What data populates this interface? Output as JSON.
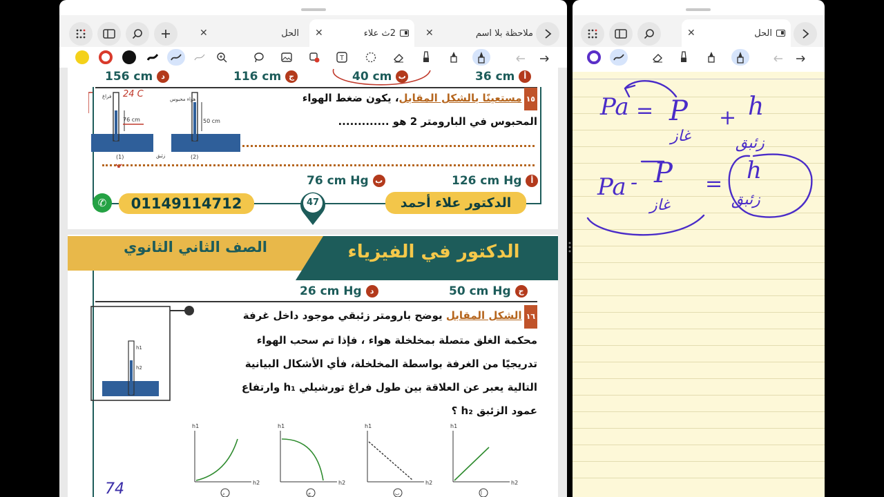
{
  "left_window": {
    "tabs": [
      {
        "label": "ملاحظة بلا اسم"
      },
      {
        "label": "2ث علاء"
      },
      {
        "label": "الحل"
      }
    ],
    "toolbar": {
      "colors": [
        "#f4d11a",
        "#d93a2b",
        "#111111"
      ]
    },
    "page": {
      "top_options": [
        {
          "letter": "د",
          "text": "156 cm"
        },
        {
          "letter": "ج",
          "text": "116 cm"
        },
        {
          "letter": "ب",
          "text": "40 cm"
        },
        {
          "letter": "أ",
          "text": "36 cm"
        }
      ],
      "q15": {
        "number": "١٥",
        "highlight": "مستعينًا بالشكل المقابل",
        "line1": "، يكون ضغط الهواء",
        "line2": "المحبوس في البارومتر 2 هو .............",
        "options": [
          {
            "letter": "ب",
            "text": "76 cm Hg"
          },
          {
            "letter": "أ",
            "text": "126 cm Hg"
          }
        ],
        "figure": {
          "label_vacuum": "فراغ",
          "label_air": "هواء محبوس",
          "label_76": "76 cm",
          "label_50": "50 cm",
          "label_mercury": "زئبق",
          "label_1": "(1)",
          "label_2": "(2)",
          "annotation": "24 C"
        }
      },
      "footer": {
        "phone": "01149114712",
        "page_number": "47",
        "author": "الدكتور علاء أحمد"
      },
      "banner": {
        "grade": "الصف الثاني الثانوي",
        "title": "الدكتور في الفيزياء"
      },
      "mid_options": [
        {
          "letter": "د",
          "text": "26 cm Hg"
        },
        {
          "letter": "ج",
          "text": "50 cm Hg"
        }
      ],
      "q16": {
        "number": "١٦",
        "highlight": "الشكل المقابل",
        "lines": [
          "يوضح بارومتر زئبقي موجود داخل غرفة",
          "محكمة الغلق متصلة بمخلخلة هواء ، فإذا تم سحب الهواء",
          "تدريجيًا من الغرفة بواسطة المخلخلة، فأي الأشكال البيانية",
          "التالية يعبر عن العلاقة بين طول فراغ تورشيلي h₁ وارتفاع",
          "عمود الزئبق h₂ ؟"
        ],
        "figure_labels": {
          "h1": "h1",
          "h2": "h2"
        },
        "graphs": [
          {
            "letter": "د",
            "ylabel": "h1",
            "xlabel": "h2"
          },
          {
            "letter": "ج",
            "ylabel": "h1",
            "xlabel": "h2"
          },
          {
            "letter": "ب",
            "ylabel": "h1",
            "xlabel": "h2"
          },
          {
            "letter": "أ",
            "ylabel": "h1",
            "xlabel": "h2"
          }
        ],
        "handwritten_mark": "74"
      }
    }
  },
  "right_window": {
    "tabs": [
      {
        "label": "الحل"
      }
    ],
    "handwriting": {
      "eq1_left": "Pa",
      "eq1_eq": "=",
      "eq1_p": "P",
      "eq1_p_sub": "غاز",
      "eq1_plus": "+",
      "eq1_h": "h",
      "eq1_h_sub": "زئبق",
      "eq2_left": "Pa",
      "eq2_minus": "-",
      "eq2_p": "P",
      "eq2_p_sub": "غاز",
      "eq2_eq": "=",
      "eq2_h": "h",
      "eq2_h_sub": "زئبق"
    }
  }
}
